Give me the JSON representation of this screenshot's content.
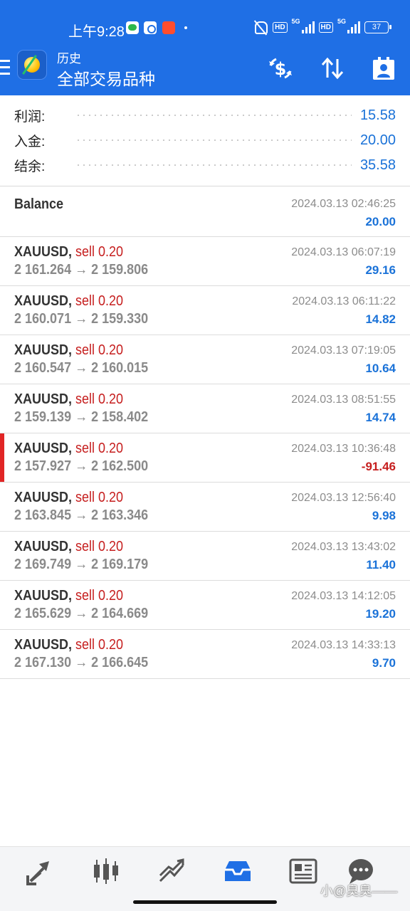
{
  "status_bar": {
    "time": "上午9:28",
    "hd1": "HD",
    "net1": "5G",
    "hd2": "HD",
    "net2": "5G",
    "battery": "37"
  },
  "app_bar": {
    "subtitle": "历史",
    "title": "全部交易品种",
    "icons": [
      "currency-exchange-icon",
      "sort-icon",
      "person-card-icon"
    ]
  },
  "summary": [
    {
      "label": "利润:",
      "value": "15.58"
    },
    {
      "label": "入金:",
      "value": "20.00"
    },
    {
      "label": "结余:",
      "value": "35.58"
    }
  ],
  "balance": {
    "label": "Balance",
    "date": "2024.03.13 02:46:25",
    "amount": "20.00"
  },
  "deals": [
    {
      "symbol": "XAUUSD,",
      "side": "sell 0.20",
      "open": "2 161.264",
      "close": "2 159.806",
      "date": "2024.03.13 06:07:19",
      "profit": "29.16"
    },
    {
      "symbol": "XAUUSD,",
      "side": "sell 0.20",
      "open": "2 160.071",
      "close": "2 159.330",
      "date": "2024.03.13 06:11:22",
      "profit": "14.82"
    },
    {
      "symbol": "XAUUSD,",
      "side": "sell 0.20",
      "open": "2 160.547",
      "close": "2 160.015",
      "date": "2024.03.13 07:19:05",
      "profit": "10.64"
    },
    {
      "symbol": "XAUUSD,",
      "side": "sell 0.20",
      "open": "2 159.139",
      "close": "2 158.402",
      "date": "2024.03.13 08:51:55",
      "profit": "14.74"
    },
    {
      "symbol": "XAUUSD,",
      "side": "sell 0.20",
      "open": "2 157.927",
      "close": "2 162.500",
      "date": "2024.03.13 10:36:48",
      "profit": "-91.46"
    },
    {
      "symbol": "XAUUSD,",
      "side": "sell 0.20",
      "open": "2 163.845",
      "close": "2 163.346",
      "date": "2024.03.13 12:56:40",
      "profit": "9.98"
    },
    {
      "symbol": "XAUUSD,",
      "side": "sell 0.20",
      "open": "2 169.749",
      "close": "2 169.179",
      "date": "2024.03.13 13:43:02",
      "profit": "11.40"
    },
    {
      "symbol": "XAUUSD,",
      "side": "sell 0.20",
      "open": "2 165.629",
      "close": "2 164.669",
      "date": "2024.03.13 14:12:05",
      "profit": "19.20"
    },
    {
      "symbol": "XAUUSD,",
      "side": "sell 0.20",
      "open": "2 167.130",
      "close": "2 166.645",
      "date": "2024.03.13 14:33:13",
      "profit": "9.70"
    }
  ],
  "arrow": "→",
  "bottom_nav": [
    "quotes-icon",
    "chart-icon",
    "trade-icon",
    "history-icon",
    "news-icon",
    "chat-icon"
  ],
  "watermark": "小@臭臭——",
  "colors": {
    "accent": "#1f6fe5",
    "positive": "#1a72d8",
    "negative": "#c61f1f",
    "sell": "#c61f1f"
  }
}
